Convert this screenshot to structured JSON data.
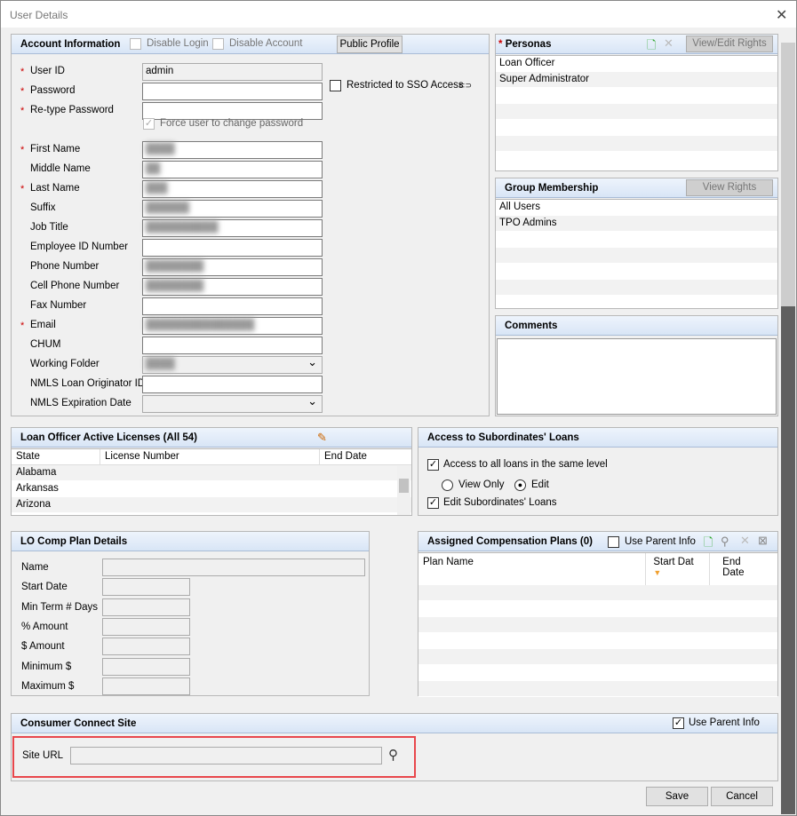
{
  "window": {
    "title": "User Details",
    "close": "✕"
  },
  "account": {
    "title": "Account Information",
    "disable_login": "Disable Login",
    "disable_account": "Disable Account",
    "public_profile": "Public Profile",
    "fields": [
      {
        "label": "User ID",
        "required": true,
        "value": "admin"
      },
      {
        "label": "Password",
        "required": true,
        "value": ""
      },
      {
        "label": "Re-type Password",
        "required": true,
        "value": ""
      },
      {
        "label": "First Name",
        "required": true,
        "value": "████"
      },
      {
        "label": "Middle Name",
        "required": false,
        "value": "██"
      },
      {
        "label": "Last Name",
        "required": true,
        "value": "███"
      },
      {
        "label": "Suffix",
        "required": false,
        "value": "██████"
      },
      {
        "label": "Job Title",
        "required": false,
        "value": "██████████"
      },
      {
        "label": "Employee ID Number",
        "required": false,
        "value": ""
      },
      {
        "label": "Phone Number",
        "required": false,
        "value": "████████"
      },
      {
        "label": "Cell Phone Number",
        "required": false,
        "value": "████████"
      },
      {
        "label": "Fax Number",
        "required": false,
        "value": ""
      },
      {
        "label": "Email",
        "required": true,
        "value": "███████████████"
      },
      {
        "label": "CHUM",
        "required": false,
        "value": ""
      },
      {
        "label": "Working Folder",
        "required": false,
        "value": "████"
      },
      {
        "label": "NMLS Loan Originator ID",
        "required": false,
        "value": ""
      },
      {
        "label": "NMLS Expiration Date",
        "required": false,
        "value": ""
      }
    ],
    "sso": "Restricted to SSO Access",
    "force_change": "Force user to change password",
    "required_mark": "*"
  },
  "personas": {
    "title": "Personas",
    "button": "View/Edit Rights",
    "items": [
      "Loan Officer",
      "Super Administrator"
    ]
  },
  "groups": {
    "title": "Group Membership",
    "button": "View Rights",
    "items": [
      "All Users",
      "TPO Admins"
    ]
  },
  "comments": {
    "title": "Comments",
    "value": ""
  },
  "licenses": {
    "title": "Loan Officer Active Licenses (All 54)",
    "columns": [
      "State",
      "License Number",
      "End Date"
    ],
    "rows": [
      "Alabama",
      "Arkansas",
      "Arizona"
    ]
  },
  "subordinates": {
    "title": "Access to Subordinates' Loans",
    "all_loans": "Access to all loans in the same level",
    "view_only": "View Only",
    "edit": "Edit",
    "edit_sub": "Edit Subordinates' Loans",
    "selected": "Edit"
  },
  "comp_plan": {
    "title": "LO Comp Plan Details",
    "fields": [
      "Name",
      "Start Date",
      "Min Term # Days",
      "% Amount",
      "$ Amount",
      "Minimum $",
      "Maximum $"
    ]
  },
  "assigned": {
    "title": "Assigned Compensation Plans (0)",
    "use_parent": "Use Parent Info",
    "columns": [
      "Plan Name",
      "Start Dat",
      "End Date"
    ]
  },
  "consumer": {
    "title": "Consumer Connect Site",
    "use_parent": "Use Parent Info",
    "site_url_label": "Site URL",
    "site_url": ""
  },
  "footer": {
    "save": "Save",
    "cancel": "Cancel"
  },
  "colors": {
    "highlight": "#e8474c",
    "required": "#cc0000"
  }
}
